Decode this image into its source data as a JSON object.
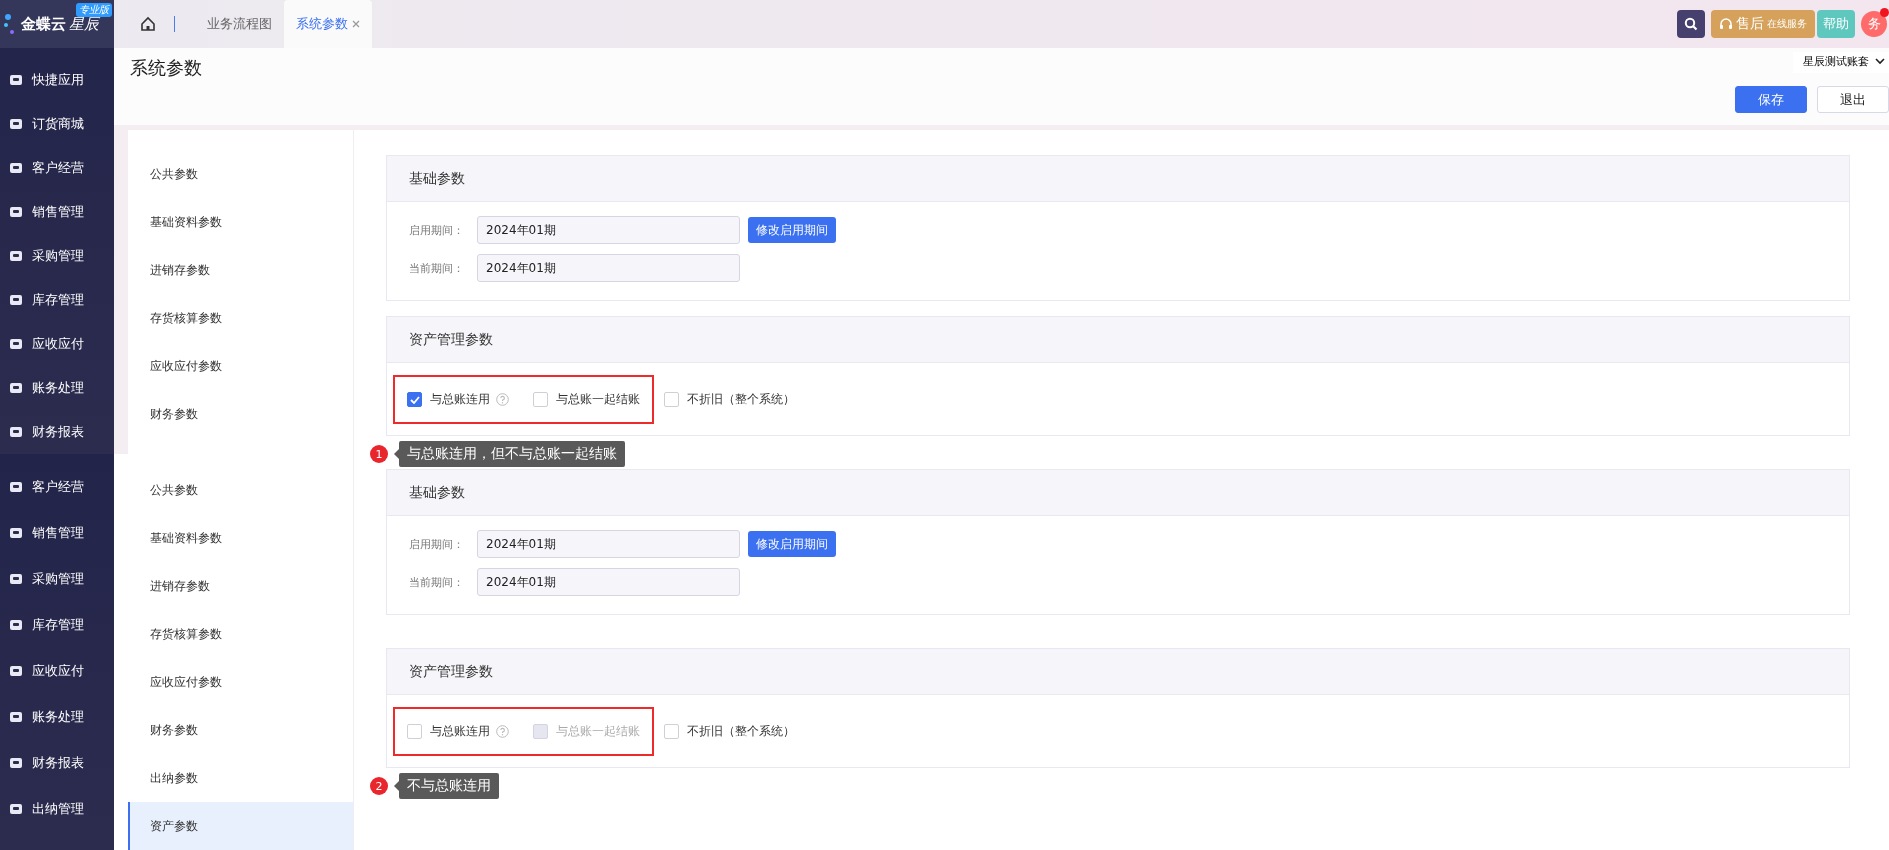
{
  "header": {
    "logo": {
      "name": "金蝶云",
      "product": "星辰",
      "edition": "专业版"
    },
    "tabs": [
      {
        "label": "业务流程图",
        "selected": false,
        "closable": false
      },
      {
        "label": "系统参数",
        "selected": true,
        "closable": true
      }
    ],
    "service": {
      "label": "售后",
      "sub": "在线服务"
    },
    "help": "帮助",
    "avatar": "务",
    "notification": true
  },
  "page": {
    "title": "系统参数",
    "account": "星辰测试账套",
    "buttons": [
      {
        "label": "保存",
        "primary": true
      },
      {
        "label": "退出",
        "primary": false
      }
    ]
  },
  "shots": [
    {
      "sidebar": [
        "快捷应用",
        "订货商城",
        "客户经营",
        "销售管理",
        "采购管理",
        "库存管理",
        "应收应付",
        "账务处理",
        "财务报表"
      ],
      "menu": [
        {
          "label": "公共参数",
          "selected": false
        },
        {
          "label": "基础资料参数",
          "selected": false
        },
        {
          "label": "进销存参数",
          "selected": false
        },
        {
          "label": "存货核算参数",
          "selected": false
        },
        {
          "label": "应收应付参数",
          "selected": false
        },
        {
          "label": "财务参数",
          "selected": false
        }
      ],
      "basic": {
        "title": "基础参数",
        "fields": [
          {
            "label": "启用期间：",
            "value": "2024年01期",
            "action": "修改启用期间"
          },
          {
            "label": "当前期间：",
            "value": "2024年01期"
          }
        ]
      },
      "asset": {
        "title": "资产管理参数",
        "groups": [
          {
            "highlighted": true,
            "options": [
              {
                "label": "与总账连用",
                "checked": true,
                "disabled": false,
                "help": true
              },
              {
                "label": "与总账一起结账",
                "checked": false,
                "disabled": false,
                "help": false
              }
            ]
          },
          {
            "highlighted": false,
            "options": [
              {
                "label": "不折旧（整个系统）",
                "checked": false,
                "disabled": false,
                "help": false
              }
            ]
          }
        ]
      },
      "callout": {
        "number": "1",
        "text": "与总账连用，但不与总账一起结账"
      }
    },
    {
      "sidebar": [
        "客户经营",
        "销售管理",
        "采购管理",
        "库存管理",
        "应收应付",
        "账务处理",
        "财务报表",
        "出纳管理"
      ],
      "menu": [
        {
          "label": "公共参数",
          "selected": false
        },
        {
          "label": "基础资料参数",
          "selected": false
        },
        {
          "label": "进销存参数",
          "selected": false
        },
        {
          "label": "存货核算参数",
          "selected": false
        },
        {
          "label": "应收应付参数",
          "selected": false
        },
        {
          "label": "财务参数",
          "selected": false
        },
        {
          "label": "出纳参数",
          "selected": false
        },
        {
          "label": "资产参数",
          "selected": true
        }
      ],
      "basic": {
        "title": "基础参数",
        "fields": [
          {
            "label": "启用期间：",
            "value": "2024年01期",
            "action": "修改启用期间"
          },
          {
            "label": "当前期间：",
            "value": "2024年01期"
          }
        ]
      },
      "asset": {
        "title": "资产管理参数",
        "groups": [
          {
            "highlighted": true,
            "options": [
              {
                "label": "与总账连用",
                "checked": false,
                "disabled": false,
                "help": true
              },
              {
                "label": "与总账一起结账",
                "checked": false,
                "disabled": true,
                "help": false
              }
            ]
          },
          {
            "highlighted": false,
            "options": [
              {
                "label": "不折旧（整个系统）",
                "checked": false,
                "disabled": false,
                "help": false
              }
            ]
          }
        ]
      },
      "callout": {
        "number": "2",
        "text": "不与总账连用"
      }
    }
  ]
}
